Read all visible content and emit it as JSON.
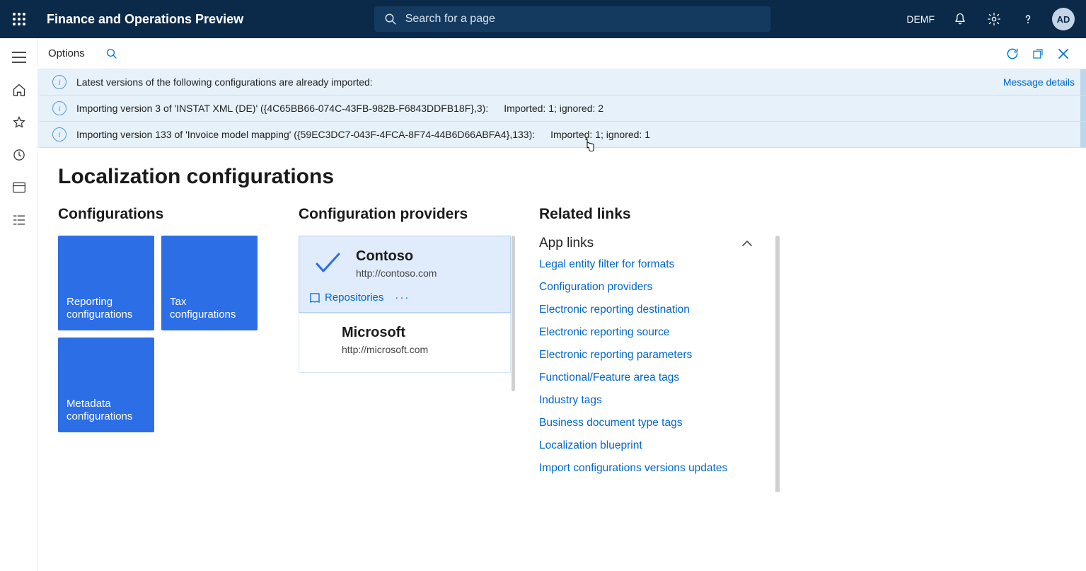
{
  "header": {
    "app_title": "Finance and Operations Preview",
    "search_placeholder": "Search for a page",
    "company": "DEMF",
    "avatar": "AD"
  },
  "subheader": {
    "options_label": "Options"
  },
  "banners": [
    {
      "text": "Latest versions of the following configurations are already imported:",
      "details_label": "Message details"
    },
    {
      "text": "Importing version 3 of 'INSTAT XML (DE)' ({4C65BB66-074C-43FB-982B-F6843DDFB18F},3):",
      "text2": "Imported: 1; ignored: 2"
    },
    {
      "text": "Importing version 133 of 'Invoice model mapping' ({59EC3DC7-043F-4FCA-8F74-44B6D66ABFA4},133):",
      "text2": "Imported: 1; ignored: 1"
    }
  ],
  "page": {
    "title": "Localization configurations",
    "configs_heading": "Configurations",
    "tiles": [
      "Reporting configurations",
      "Tax configurations",
      "Metadata configurations"
    ],
    "providers_heading": "Configuration providers",
    "providers": [
      {
        "name": "Contoso",
        "url": "http://contoso.com",
        "active": true,
        "repositories_label": "Repositories"
      },
      {
        "name": "Microsoft",
        "url": "http://microsoft.com",
        "active": false
      }
    ],
    "related_heading": "Related links",
    "applinks_heading": "App links",
    "links": [
      "Legal entity filter for formats",
      "Configuration providers",
      "Electronic reporting destination",
      "Electronic reporting source",
      "Electronic reporting parameters",
      "Functional/Feature area tags",
      "Industry tags",
      "Business document type tags",
      "Localization blueprint",
      "Import configurations versions updates"
    ]
  },
  "colors": {
    "accent": "#2b6ee6",
    "link": "#0066cc",
    "topbar": "#0b2a4a",
    "banner": "#e6f1fa"
  }
}
